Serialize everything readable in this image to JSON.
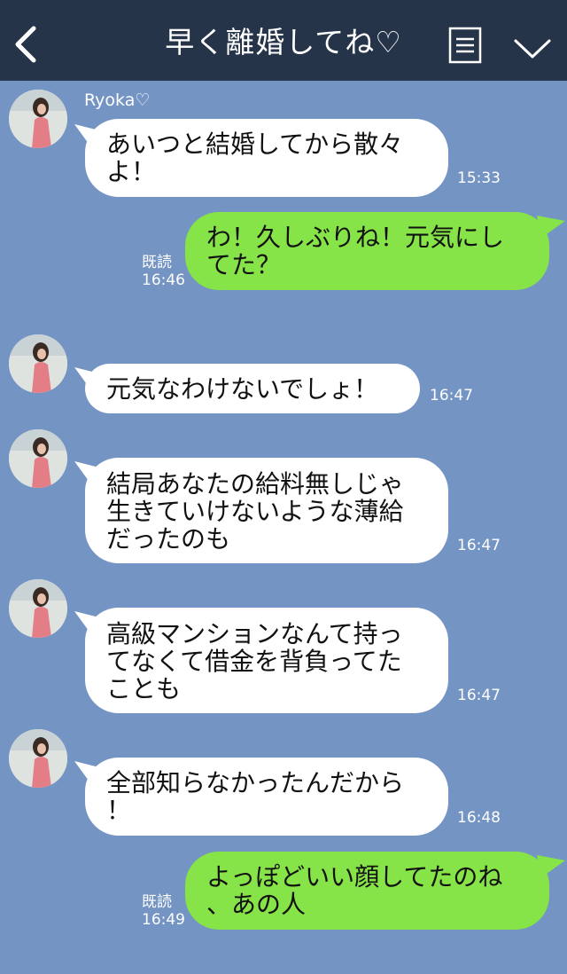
{
  "header": {
    "title": "早く離婚してね♡"
  },
  "contact": {
    "name": "Ryoka♡"
  },
  "colors": {
    "header_bg": "#263449",
    "chat_bg": "#7494c3",
    "incoming_bubble": "#ffffff",
    "outgoing_bubble": "#86e348"
  },
  "icons": {
    "back": "chevron-left-icon",
    "menu": "menu-icon",
    "collapse": "chevron-down-icon"
  },
  "messages": [
    {
      "dir": "in",
      "text": "あいつと結婚してから散々\nよ！",
      "time": "15:33"
    },
    {
      "dir": "out",
      "text": "わ！久しぶりね！元気にし\nてた？",
      "read": "既読",
      "time": "16:46"
    },
    {
      "dir": "in",
      "text": "元気なわけないでしょ！",
      "time": "16:47"
    },
    {
      "dir": "in",
      "text": "結局あなたの給料無しじゃ\n生きていけないような薄給\nだったのも",
      "time": "16:47"
    },
    {
      "dir": "in",
      "text": "高級マンションなんて持っ\nてなくて借金を背負ってた\nことも",
      "time": "16:47"
    },
    {
      "dir": "in",
      "text": "全部知らなかったんだから\n！",
      "time": "16:48"
    },
    {
      "dir": "out",
      "text": "よっぽどいい顔してたのね\n、あの人",
      "read": "既読",
      "time": "16:49"
    }
  ]
}
